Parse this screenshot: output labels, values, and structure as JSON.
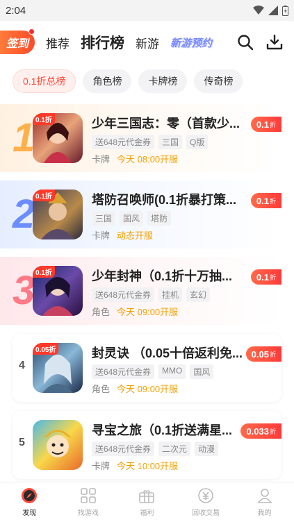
{
  "status_bar": {
    "time": "2:04",
    "icons": [
      "wifi-icon",
      "signal-icon",
      "battery-icon"
    ]
  },
  "top_nav": {
    "signin_label": "签到",
    "tabs": [
      {
        "label": "推荐"
      },
      {
        "label": "排行榜",
        "active": true
      },
      {
        "label": "新游"
      },
      {
        "label": "新游预约"
      }
    ],
    "actions": [
      "search-icon",
      "download-icon"
    ]
  },
  "chips": [
    {
      "label": "0.1折总榜",
      "active": true
    },
    {
      "label": "角色榜"
    },
    {
      "label": "卡牌榜"
    },
    {
      "label": "传奇榜"
    }
  ],
  "games": [
    {
      "rank": "1",
      "title": "少年三国志：零（首款少...",
      "icon_badge": "0.1折",
      "tags": [
        "送648元代金券",
        "三国",
        "Q版"
      ],
      "category": "卡牌",
      "open_time": "今天 08:00开服",
      "discount": "0.1",
      "discount_unit": "折"
    },
    {
      "rank": "2",
      "title": "塔防召唤师(0.1折暴打策...",
      "icon_badge": "0.1折",
      "tags": [
        "三国",
        "国风",
        "塔防"
      ],
      "category": "卡牌",
      "open_time": "动态开服",
      "discount": "0.1",
      "discount_unit": "折"
    },
    {
      "rank": "3",
      "title": "少年封神（0.1折十万抽...",
      "icon_badge": "0.1折",
      "tags": [
        "送648元代金券",
        "挂机",
        "玄幻"
      ],
      "category": "角色",
      "open_time": "今天 09:00开服",
      "discount": "0.1",
      "discount_unit": "折"
    },
    {
      "rank": "4",
      "title": "封灵诀 （0.05十倍返利免...",
      "icon_badge": "0.05折",
      "tags": [
        "送648元代金券",
        "MMO",
        "国风"
      ],
      "category": "角色",
      "open_time": "今天 09:00开服",
      "discount": "0.05",
      "discount_unit": "折"
    },
    {
      "rank": "5",
      "title": "寻宝之旅（0.1折送满星...",
      "icon_badge": "",
      "tags": [
        "送648元代金券",
        "二次元",
        "动漫"
      ],
      "category": "卡牌",
      "open_time": "今天 10:00开服",
      "discount": "0.033",
      "discount_unit": "折"
    }
  ],
  "bottom_nav": [
    {
      "label": "发现",
      "icon": "compass-icon",
      "active": true
    },
    {
      "label": "找游戏",
      "icon": "grid-icon"
    },
    {
      "label": "福利",
      "icon": "gift-icon"
    },
    {
      "label": "回收交易",
      "icon": "recycle-coin-icon"
    },
    {
      "label": "我的",
      "icon": "user-icon"
    }
  ],
  "colors": {
    "accent": "#ff4a3a",
    "rank1": "#ffb04a",
    "rank2": "#6b8dff",
    "rank3": "#ff7a86",
    "open_time": "#f2a000"
  }
}
